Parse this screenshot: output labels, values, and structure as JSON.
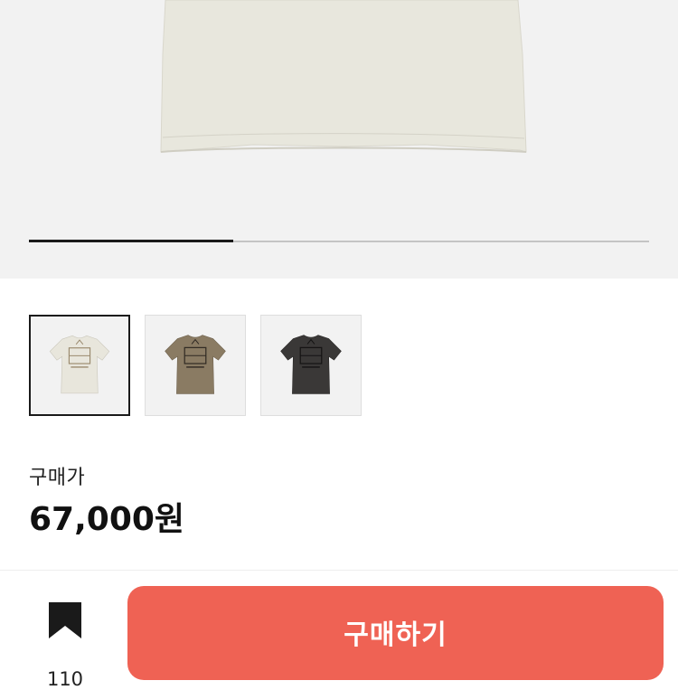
{
  "gallery": {
    "progress": 0.33,
    "thumbnails": [
      {
        "color": "#e8e6dc",
        "selected": true
      },
      {
        "color": "#8a7b63",
        "selected": false
      },
      {
        "color": "#3a3837",
        "selected": false
      }
    ],
    "main_shirt_color": "#e8e7dd"
  },
  "product": {
    "price_label": "구매가",
    "price": "67,000원"
  },
  "bottom_bar": {
    "bookmark_icon": "bookmark-icon",
    "bookmark_count": "110",
    "buy_label": "구매하기",
    "buy_color": "#ef6254"
  }
}
